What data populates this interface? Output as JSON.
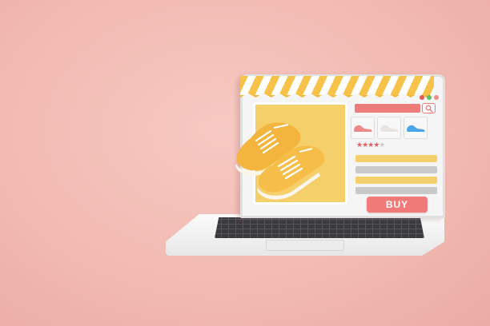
{
  "store": {
    "buy_label": "BUY",
    "rating": 4,
    "rating_max": 5
  },
  "icons": {
    "search": "search-icon",
    "window_dots": [
      "red",
      "green",
      "pink"
    ]
  },
  "colors": {
    "background": "#f1b9b1",
    "accent": "#ef7a78",
    "awning_yellow": "#f7c24a",
    "product_panel": "#f5cf6a",
    "bar_yellow": "#f5cf6a",
    "bar_gray": "#c9c9c9"
  },
  "thumbnails": [
    {
      "name": "pink-sneaker",
      "color": "#ea8a8a"
    },
    {
      "name": "white-sneaker",
      "color": "#eeeeee"
    },
    {
      "name": "blue-sneaker",
      "color": "#4aa6e8"
    }
  ]
}
